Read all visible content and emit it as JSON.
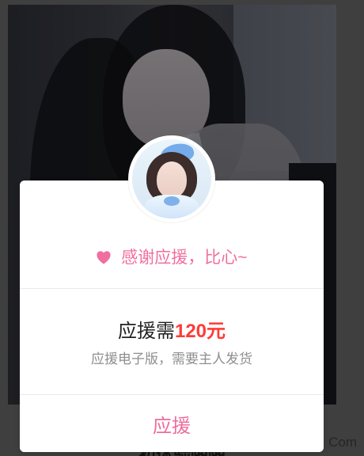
{
  "modal": {
    "thanks_text": "感谢应援，比心~",
    "price_prefix": "应援需",
    "price_value": "120元",
    "subtext": "应援电子版，需要主人发货",
    "button_label": "应援"
  },
  "background": {
    "under_text": "初体验啪啪",
    "corner_text": "Com"
  },
  "icons": {
    "heart": "heart-icon"
  },
  "colors": {
    "accent_pink": "#f06f9f",
    "price_red": "#ff3b36",
    "subtext_gray": "#8e8e8e"
  }
}
